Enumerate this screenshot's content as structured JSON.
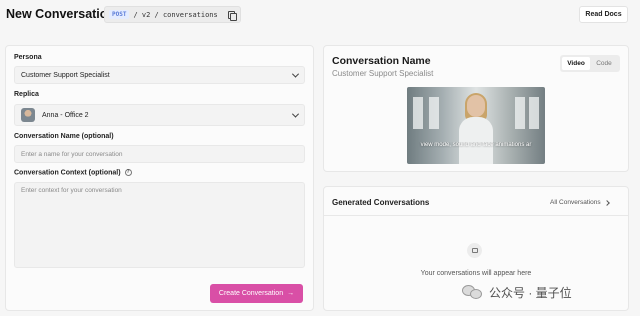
{
  "header": {
    "title": "New Conversation",
    "endpoint_method": "POST",
    "endpoint_path": "/ v2 / conversations",
    "read_docs_label": "Read Docs"
  },
  "form": {
    "persona_label": "Persona",
    "persona_value": "Customer Support Specialist",
    "replica_label": "Replica",
    "replica_value": "Anna - Office 2",
    "name_label": "Conversation Name (optional)",
    "name_placeholder": "Enter a name for your conversation",
    "context_label": "Conversation Context (optional)",
    "context_help": "?",
    "context_placeholder": "Enter context for your conversation",
    "create_label": "Create Conversation",
    "create_arrow": "→"
  },
  "preview": {
    "title": "Conversation Name",
    "subtitle": "Customer Support Specialist",
    "tabs": [
      "Video",
      "Code"
    ],
    "active_tab": "Video",
    "video_caption": "view mode, sound and face animations ar"
  },
  "generated": {
    "title": "Generated Conversations",
    "all_link": "All Conversations",
    "empty_text": "Your conversations will appear here"
  },
  "watermark": {
    "text": "公众号 · 量子位"
  },
  "colors": {
    "accent": "#d94fa6",
    "background": "#f6f6f6",
    "card": "#fbfbfb"
  }
}
